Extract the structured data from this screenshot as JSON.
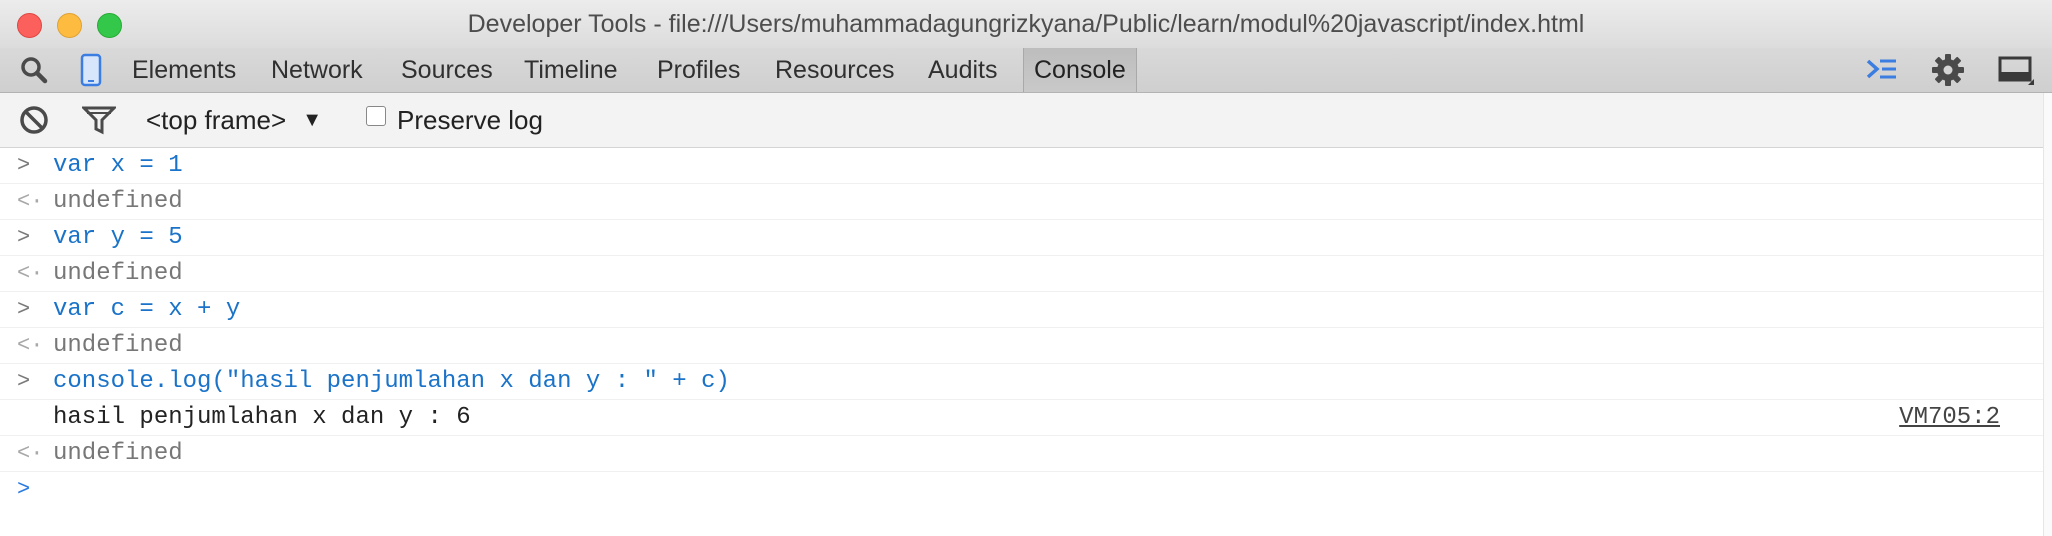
{
  "window": {
    "title": "Developer Tools - file:///Users/muhammadagungrizkyana/Public/learn/modul%20javascript/index.html"
  },
  "tabs": [
    {
      "label": "Elements"
    },
    {
      "label": "Network"
    },
    {
      "label": "Sources"
    },
    {
      "label": "Timeline"
    },
    {
      "label": "Profiles"
    },
    {
      "label": "Resources"
    },
    {
      "label": "Audits"
    },
    {
      "label": "Console",
      "selected": true
    }
  ],
  "toolbar": {
    "icons": [
      "search-icon",
      "device-mode-icon",
      "console-drawer-icon",
      "gear-icon",
      "dock-icon"
    ],
    "accent_color": "#3b7de0"
  },
  "console_toolbar": {
    "frame": "<top frame>",
    "frame_arrow": "▼",
    "preserve_log_label": "Preserve log",
    "preserve_log_checked": false
  },
  "messages": [
    {
      "type": "command",
      "prompt": ">",
      "text": "var x = 1"
    },
    {
      "type": "result",
      "prompt": "<·",
      "text": "undefined"
    },
    {
      "type": "command",
      "prompt": ">",
      "text": "var y = 5"
    },
    {
      "type": "result",
      "prompt": "<·",
      "text": "undefined"
    },
    {
      "type": "command",
      "prompt": ">",
      "text": "var c = x + y"
    },
    {
      "type": "result",
      "prompt": "<·",
      "text": "undefined"
    },
    {
      "type": "command",
      "prompt": ">",
      "text": "console.log(\"hasil penjumlahan x dan y : \" + c)"
    },
    {
      "type": "log",
      "prompt": "",
      "text": "hasil penjumlahan x dan y : 6",
      "source": "VM705:2"
    },
    {
      "type": "result",
      "prompt": "<·",
      "text": "undefined"
    }
  ],
  "input_prompt": ">",
  "colors": {
    "command_text": "#1a73c8",
    "result_text": "#777777",
    "log_text": "#222222"
  }
}
